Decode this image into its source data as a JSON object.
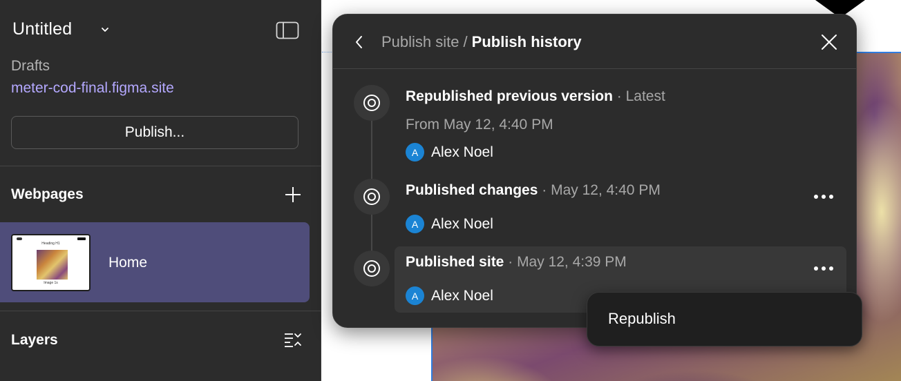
{
  "app": {
    "file_title": "Untitled",
    "drafts_label": "Drafts",
    "site_url": "meter-cod-final.figma.site",
    "publish_button": "Publish..."
  },
  "webpages": {
    "title": "Webpages",
    "pages": [
      {
        "name": "Home",
        "thumb_heading": "Heading H1",
        "thumb_caption": "Image 1s",
        "selected": true
      }
    ]
  },
  "layers": {
    "title": "Layers"
  },
  "dialog": {
    "breadcrumb_parent": "Publish site",
    "breadcrumb_separator": "/",
    "breadcrumb_current": "Publish history",
    "entries": [
      {
        "title": "Republished previous version",
        "separator": "·",
        "meta": "Latest",
        "subtitle": "From May 12, 4:40 PM",
        "author_initial": "A",
        "author": "Alex Noel",
        "has_menu": false
      },
      {
        "title": "Published changes",
        "separator": "·",
        "meta": "May 12, 4:40 PM",
        "author_initial": "A",
        "author": "Alex Noel",
        "has_menu": true
      },
      {
        "title": "Published site",
        "separator": "·",
        "meta": "May 12, 4:39 PM",
        "author_initial": "A",
        "author": "Alex Noel",
        "has_menu": true,
        "highlighted": true
      }
    ]
  },
  "context_menu": {
    "items": [
      "Republish"
    ]
  },
  "icons": {
    "title_dropdown": "chevron-down-icon",
    "panel_toggle": "sidebar-toggle-icon",
    "add_page": "plus-icon",
    "layers_options": "list-collapse-icon",
    "back": "chevron-left-icon",
    "close": "close-icon",
    "timeline": "target-circle-icon",
    "more": "more-horizontal-icon"
  },
  "colors": {
    "sidebar_bg": "#2c2c2c",
    "selected_page_bg": "#4f4d7a",
    "link": "#b4a8ff",
    "avatar": "#1b84d4",
    "dialog_bg": "#2c2c2c",
    "menu_bg": "#1f1f1f"
  }
}
